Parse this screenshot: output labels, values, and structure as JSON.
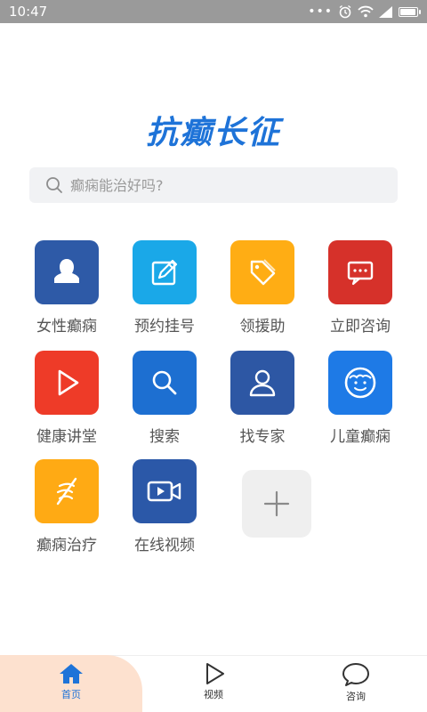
{
  "status": {
    "time": "10:47"
  },
  "app": {
    "title": "抗癫长征"
  },
  "search": {
    "placeholder": "癫痫能治好吗?"
  },
  "grid": [
    {
      "label": "女性癫痫",
      "color": "#2e5aa7",
      "icon": "woman-icon"
    },
    {
      "label": "预约挂号",
      "color": "#1aa8e8",
      "icon": "edit-icon"
    },
    {
      "label": "领援助",
      "color": "#ffad14",
      "icon": "tag-icon"
    },
    {
      "label": "立即咨询",
      "color": "#d6312a",
      "icon": "chat-icon"
    },
    {
      "label": "健康讲堂",
      "color": "#ee3b28",
      "icon": "play-icon"
    },
    {
      "label": "搜索",
      "color": "#1d6fd1",
      "icon": "search-icon"
    },
    {
      "label": "找专家",
      "color": "#2d57a4",
      "icon": "person-icon"
    },
    {
      "label": "儿童癫痫",
      "color": "#1e7ae6",
      "icon": "child-icon"
    },
    {
      "label": "癫痫治疗",
      "color": "#ffaa14",
      "icon": "dna-icon"
    },
    {
      "label": "在线视频",
      "color": "#2b58a8",
      "icon": "video-icon"
    }
  ],
  "add_tile": {
    "icon": "plus-icon"
  },
  "tabs": [
    {
      "label": "首页",
      "icon": "home-icon",
      "active": true
    },
    {
      "label": "视频",
      "icon": "play-outline-icon",
      "active": false
    },
    {
      "label": "咨询",
      "icon": "speech-bubble-icon",
      "active": false
    }
  ],
  "colors": {
    "accent": "#1e73d8",
    "tab_highlight": "#fde1cf"
  }
}
